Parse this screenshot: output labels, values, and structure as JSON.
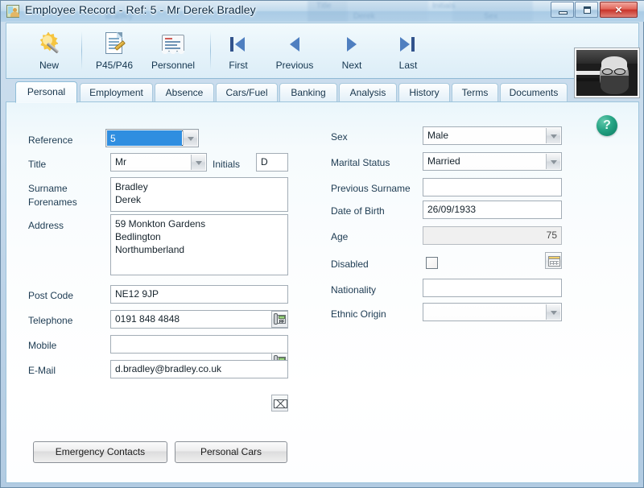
{
  "window": {
    "title": "Employee Record - Ref: 5 - Mr Derek Bradley",
    "app_icon": "employee-photo-icon",
    "controls": {
      "minimize": "minimize-button",
      "maximize": "maximize-button",
      "close": "close-button",
      "close_glyph": "×"
    },
    "ghost_titles": [
      "Title",
      "Surname",
      "Bradley",
      "Initials",
      "Derek",
      "Sex"
    ]
  },
  "toolbar": {
    "buttons": [
      {
        "label": "New",
        "icon": "wand-new-icon",
        "accel_index": 0
      },
      {
        "label": "P45/P46",
        "icon": "document-edit-icon"
      },
      {
        "label": "Personnel",
        "icon": "certificate-icon"
      },
      {
        "label": "First",
        "icon": "first-record-icon",
        "accel": "i"
      },
      {
        "label": "Previous",
        "icon": "previous-record-icon",
        "accel": "P"
      },
      {
        "label": "Next",
        "icon": "next-record-icon",
        "accel": "N"
      },
      {
        "label": "Last",
        "icon": "last-record-icon",
        "accel": "L"
      }
    ],
    "photo": "employee-photo"
  },
  "tabs": {
    "items": [
      {
        "label": "Personal",
        "active": true
      },
      {
        "label": "Employment",
        "active": false
      },
      {
        "label": "Absence",
        "active": false
      },
      {
        "label": "Cars/Fuel",
        "active": false
      },
      {
        "label": "Banking",
        "active": false
      },
      {
        "label": "Analysis",
        "active": false
      },
      {
        "label": "History",
        "active": false
      },
      {
        "label": "Terms",
        "active": false
      },
      {
        "label": "Documents",
        "active": false
      }
    ]
  },
  "form": {
    "left": {
      "reference_label": "Reference",
      "reference_value": "5",
      "title_label": "Title",
      "title_value": "Mr",
      "initials_label": "Initials",
      "initials_value": "D",
      "surname_label": "Surname",
      "forenames_label": "Forenames",
      "names_value": "Bradley\nDerek",
      "address_label": "Address",
      "address_value": "59 Monkton Gardens\nBedlington\nNorthumberland",
      "postcode_label": "Post Code",
      "postcode_value": "NE12 9JP",
      "telephone_label": "Telephone",
      "telephone_value": "0191 848 4848",
      "mobile_label": "Mobile",
      "mobile_value": "",
      "email_label": "E-Mail",
      "email_value": "d.bradley@bradley.co.uk"
    },
    "right": {
      "sex_label": "Sex",
      "sex_value": "Male",
      "marital_label": "Marital Status",
      "marital_value": "Married",
      "prev_surname_label": "Previous Surname",
      "prev_surname_value": "",
      "dob_label": "Date of Birth",
      "dob_value": "26/09/1933",
      "age_label": "Age",
      "age_value": "75",
      "disabled_label": "Disabled",
      "disabled_checked": false,
      "nationality_label": "Nationality",
      "nationality_value": "",
      "ethnic_label": "Ethnic Origin",
      "ethnic_value": ""
    },
    "buttons": {
      "emergency": "Emergency Contacts",
      "cars": "Personal Cars"
    },
    "help": "?"
  },
  "colors": {
    "accent_blue": "#2f8ee0",
    "help_green": "#25a383",
    "title_text": "#0c2a42",
    "close_red": "#c8342a",
    "nav_arrow": "#4f7fc0"
  }
}
